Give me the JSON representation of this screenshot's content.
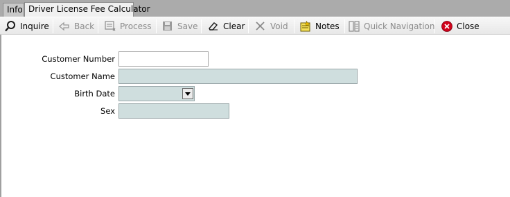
{
  "tabs": [
    {
      "label": "Info"
    },
    {
      "label": "Driver License Fee Calculator"
    }
  ],
  "toolbar": {
    "inquire": "Inquire",
    "back": "Back",
    "process": "Process",
    "save": "Save",
    "clear": "Clear",
    "void": "Void",
    "notes": "Notes",
    "quick_navigation": "Quick Navigation",
    "close": "Close"
  },
  "form": {
    "customer_number": {
      "label": "Customer Number",
      "value": ""
    },
    "customer_name": {
      "label": "Customer Name",
      "value": ""
    },
    "birth_date": {
      "label": "Birth Date",
      "value": ""
    },
    "sex": {
      "label": "Sex",
      "value": ""
    }
  },
  "colors": {
    "readonly_field": "#cfdede",
    "close_icon": "#d0021b"
  }
}
